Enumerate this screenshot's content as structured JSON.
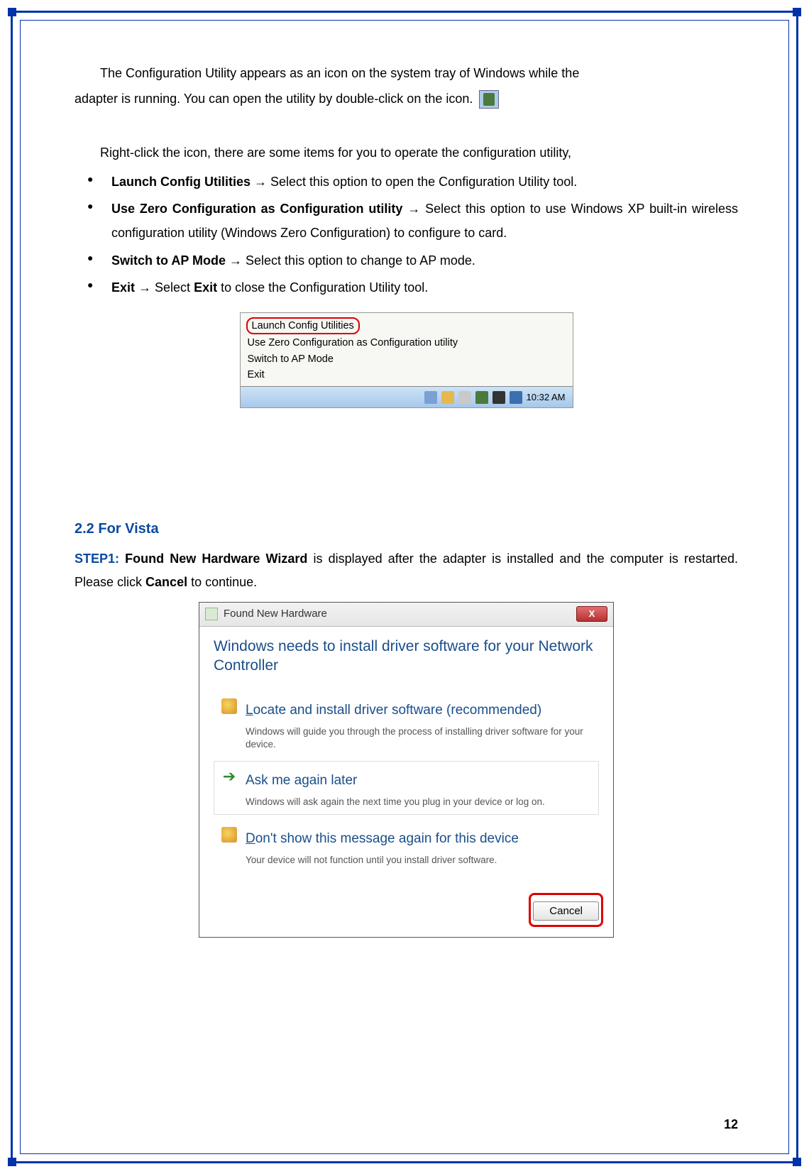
{
  "intro": {
    "line1": "The Configuration Utility appears as an icon on the system tray of Windows while the",
    "line2_pre": "adapter is running. You can open the utility by double-click on the icon.",
    "rightclick": "Right-click the icon, there are some items for you to operate the configuration utility,"
  },
  "bullets": [
    {
      "bold": "Launch Config Utilities",
      "rest": "Select this option to open the Configuration Utility tool."
    },
    {
      "bold": "Use Zero Configuration as Configuration utility",
      "rest": "Select this option to use Windows XP built-in wireless configuration utility (Windows Zero Configuration) to configure to card."
    },
    {
      "bold": "Switch to AP Mode",
      "rest": "Select this option to change to AP mode."
    },
    {
      "bold": "Exit",
      "rest_pre": "Select ",
      "rest_bold": "Exit",
      "rest_post": " to close the Configuration Utility tool."
    }
  ],
  "context_menu": {
    "items": [
      "Launch Config Utilities",
      "Use Zero Configuration as Configuration utility",
      "Switch to AP Mode",
      "Exit"
    ],
    "clock": "10:32 AM"
  },
  "section22": {
    "heading": "2.2 For Vista",
    "step_label": "STEP1:",
    "step_bold": "Found New Hardware Wizard",
    "step_mid": " is displayed after the adapter is installed and the computer is restarted. Please click ",
    "step_bold2": "Cancel",
    "step_end": " to continue."
  },
  "vista_dialog": {
    "title": "Found New Hardware",
    "close_x": "X",
    "headline": "Windows needs to install driver software for your Network Controller",
    "options": [
      {
        "title_u": "L",
        "title_rest": "ocate and install driver software (recommended)",
        "desc": "Windows will guide you through the process of installing driver software for your device.",
        "icon": "shield"
      },
      {
        "title_u": "",
        "title_rest": "Ask me again later",
        "desc": "Windows will ask again the next time you plug in your device or log on.",
        "icon": "arrow"
      },
      {
        "title_u": "D",
        "title_rest": "on't show this message again for this device",
        "desc": "Your device will not function until you install driver software.",
        "icon": "shield"
      }
    ],
    "cancel": "Cancel"
  },
  "page_number": "12"
}
